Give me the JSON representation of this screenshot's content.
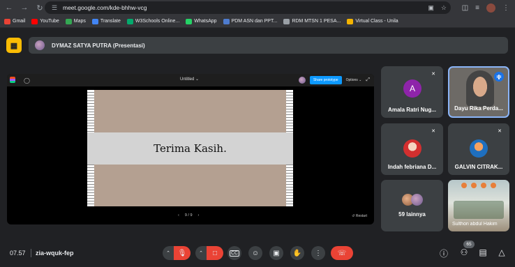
{
  "browser": {
    "url": "meet.google.com/kde-bhhw-vcg",
    "bookmarks": [
      {
        "label": "Gmail",
        "color": "#ea4335"
      },
      {
        "label": "YouTube",
        "color": "#ff0000"
      },
      {
        "label": "Maps",
        "color": "#34a853"
      },
      {
        "label": "Translate",
        "color": "#4285f4"
      },
      {
        "label": "W3Schools Online...",
        "color": "#04aa6d"
      },
      {
        "label": "WhatsApp",
        "color": "#25d366"
      },
      {
        "label": "PDM ASN dan PPT...",
        "color": "#4e7ccf"
      },
      {
        "label": "RDM MTSN 1 PESA...",
        "color": "#9aa0a6"
      },
      {
        "label": "Virtual Class - Unila",
        "color": "#f4b400"
      }
    ]
  },
  "presenter": {
    "label": "DYMAZ SATYA PUTRA (Presentasi)"
  },
  "shared_screen": {
    "doc_title": "Untitled",
    "share_button": "Share prototype",
    "options_label": "Options",
    "slide_text": "Terima Kasih.",
    "page_indicator": "9 / 9",
    "restart_label": "Restart"
  },
  "participants": [
    {
      "name": "Amala Ratri Nug...",
      "avatar_letter": "A",
      "muted": true
    },
    {
      "name": "Dayu Rika Perda...",
      "speaking": true
    },
    {
      "name": "Indah febriana D...",
      "muted": true
    },
    {
      "name": "GALVIN CITRAK...",
      "muted": true
    },
    {
      "name": "59 lainnya"
    },
    {
      "name": "Sulthon abdul Hakim"
    }
  ],
  "footer": {
    "time": "07.57",
    "meeting_code": "zia-wquk-fep",
    "people_count": "65"
  },
  "colors": {
    "accent_blue": "#8ab4f8",
    "danger_red": "#ea4335",
    "present_yellow": "#fbbc04"
  }
}
